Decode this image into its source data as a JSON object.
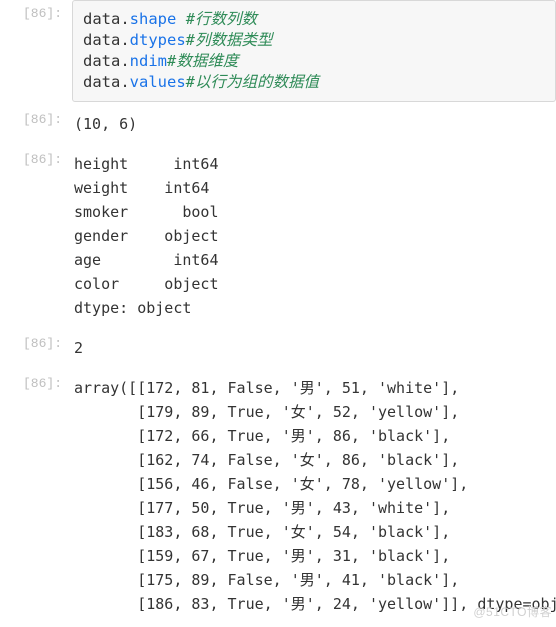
{
  "input": {
    "prompt": "[86]:",
    "lines": {
      "l1": {
        "obj": "data",
        "dot": ".",
        "attr": "shape",
        "sp": " ",
        "comment": "#行数列数"
      },
      "l2": {
        "obj": "data",
        "dot": ".",
        "attr": "dtypes",
        "sp": "",
        "comment": "#列数据类型"
      },
      "l3": {
        "obj": "data",
        "dot": ".",
        "attr": "ndim",
        "sp": "",
        "comment": "#数据维度"
      },
      "l4": {
        "obj": "data",
        "dot": ".",
        "attr": "values",
        "sp": "",
        "comment": "#以行为组的数据值"
      }
    }
  },
  "outputs": {
    "o1": {
      "prompt": "[86]:",
      "text": "(10, 6)"
    },
    "o2": {
      "prompt": "[86]:",
      "text": "height     int64\nweight    int64\nsmoker      bool\ngender    object\nage        int64\ncolor     object\ndtype: object"
    },
    "o3": {
      "prompt": "[86]:",
      "text": "2"
    },
    "o4": {
      "prompt": "[86]:",
      "text": "array([[172, 81, False, '男', 51, 'white'],\n       [179, 89, True, '女', 52, 'yellow'],\n       [172, 66, True, '男', 86, 'black'],\n       [162, 74, False, '女', 86, 'black'],\n       [156, 46, False, '女', 78, 'yellow'],\n       [177, 50, True, '男', 43, 'white'],\n       [183, 68, True, '女', 54, 'black'],\n       [159, 67, True, '男', 31, 'black'],\n       [175, 89, False, '男', 41, 'black'],\n       [186, 83, True, '男', 24, 'yellow']], dtype=object)"
    }
  },
  "watermark": "@51CTO博客"
}
